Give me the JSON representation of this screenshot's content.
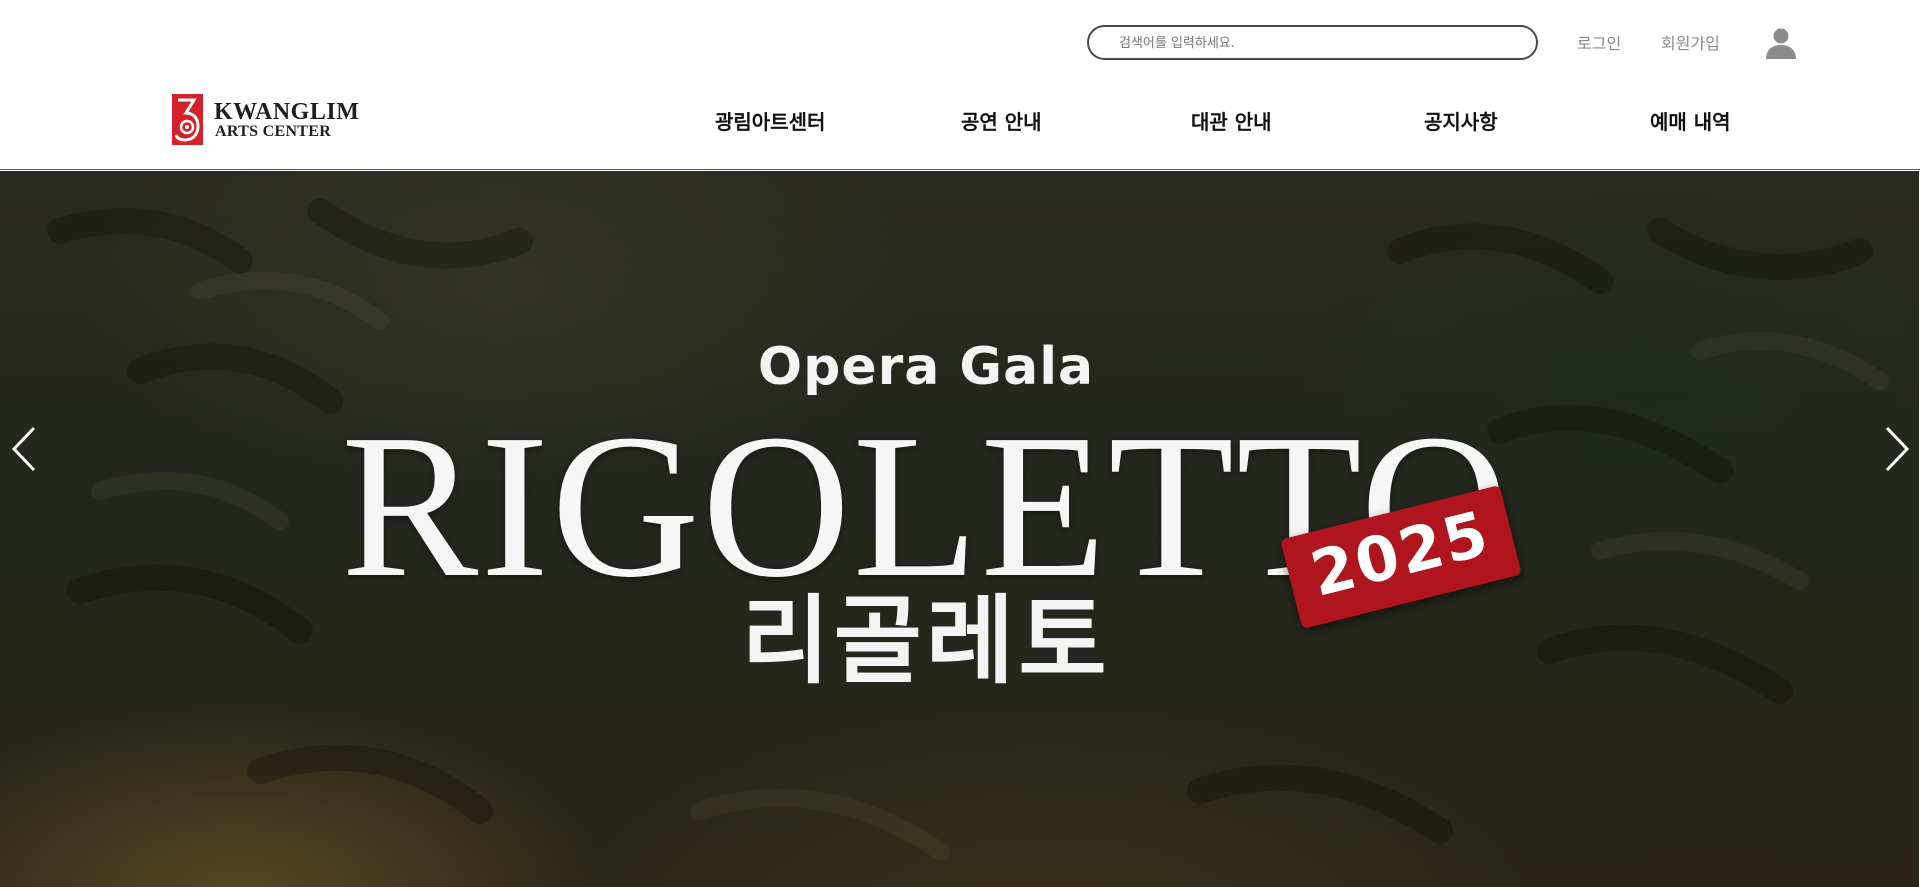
{
  "header": {
    "search": {
      "placeholder": "검색어를 입력하세요.",
      "value": ""
    },
    "login_label": "로그인",
    "signup_label": "회원가입",
    "user_icon": "user-icon",
    "logo": {
      "line1": "KWANGLIM",
      "line2": "ARTS CENTER"
    },
    "accent_color": "#d3222a"
  },
  "nav": {
    "items": [
      {
        "label": "광림아트센터"
      },
      {
        "label": "공연 안내"
      },
      {
        "label": "대관 안내"
      },
      {
        "label": "공지사항"
      },
      {
        "label": "예매 내역"
      }
    ]
  },
  "hero": {
    "subtitle": "Opera Gala",
    "title": "RIGOLETTO",
    "badge": "2025",
    "title_ko": "리골레토",
    "badge_color": "#b0141d",
    "prev_icon": "chevron-left-icon",
    "next_icon": "chevron-right-icon"
  }
}
